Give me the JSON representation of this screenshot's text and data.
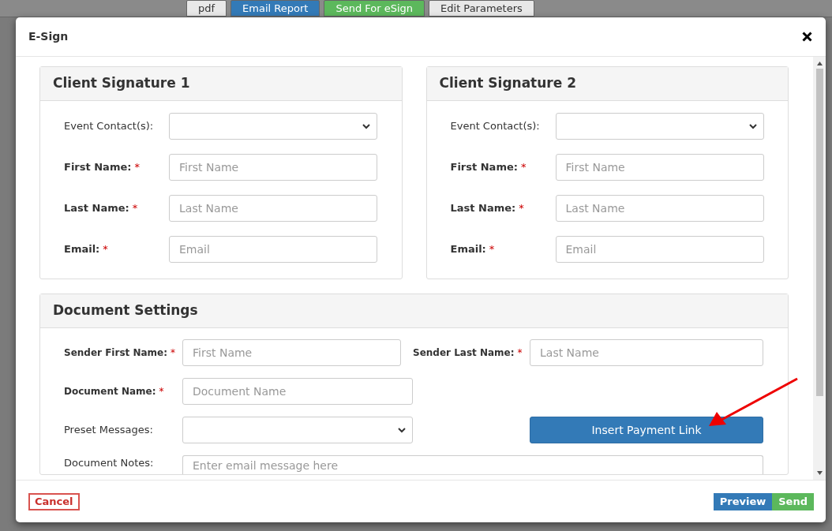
{
  "background_toolbar": [
    {
      "label": "pdf",
      "color": "#e8e8e8"
    },
    {
      "label": "Email Report",
      "color": "#337ab7"
    },
    {
      "label": "Send For eSign",
      "color": "#5cb85c"
    },
    {
      "label": "Edit Parameters",
      "color": "#e8e8e8"
    }
  ],
  "dialog": {
    "title": "E-Sign",
    "signatures": [
      {
        "title": "Client Signature 1",
        "fields": [
          {
            "kind": "select",
            "label": "Event Contact(s):"
          },
          {
            "kind": "text",
            "label": "First Name:",
            "required_mark": "*",
            "placeholder": "First Name"
          },
          {
            "kind": "text",
            "label": "Last Name:",
            "required_mark": "*",
            "placeholder": "Last Name"
          },
          {
            "kind": "text",
            "label": "Email:",
            "required_mark": "*",
            "placeholder": "Email"
          }
        ]
      },
      {
        "title": "Client Signature 2",
        "fields": [
          {
            "kind": "select",
            "label": "Event Contact(s):"
          },
          {
            "kind": "text",
            "label": "First Name:",
            "required_mark": "*",
            "placeholder": "First Name"
          },
          {
            "kind": "text",
            "label": "Last Name:",
            "required_mark": "*",
            "placeholder": "Last Name"
          },
          {
            "kind": "text",
            "label": "Email:",
            "required_mark": "*",
            "placeholder": "Email"
          }
        ]
      }
    ],
    "document_settings": {
      "title": "Document Settings",
      "rows": [
        [
          {
            "kind": "text",
            "label": "Sender First Name:",
            "required_mark": "*",
            "placeholder": "First Name"
          },
          {
            "kind": "text",
            "label": "Sender Last Name:",
            "required_mark": "*",
            "placeholder": "Last Name"
          }
        ],
        [
          {
            "kind": "text",
            "label": "Document Name:",
            "required_mark": "*",
            "placeholder": "Document Name"
          }
        ],
        [
          {
            "kind": "select",
            "label": "Preset Messages:"
          },
          {
            "kind": "button",
            "label": "Insert Payment Link"
          }
        ],
        [
          {
            "kind": "textarea",
            "label": "Document Notes:",
            "placeholder": "Enter email message here"
          }
        ]
      ]
    },
    "footer": {
      "cancel": "Cancel",
      "preview": "Preview",
      "send": "Send"
    }
  }
}
